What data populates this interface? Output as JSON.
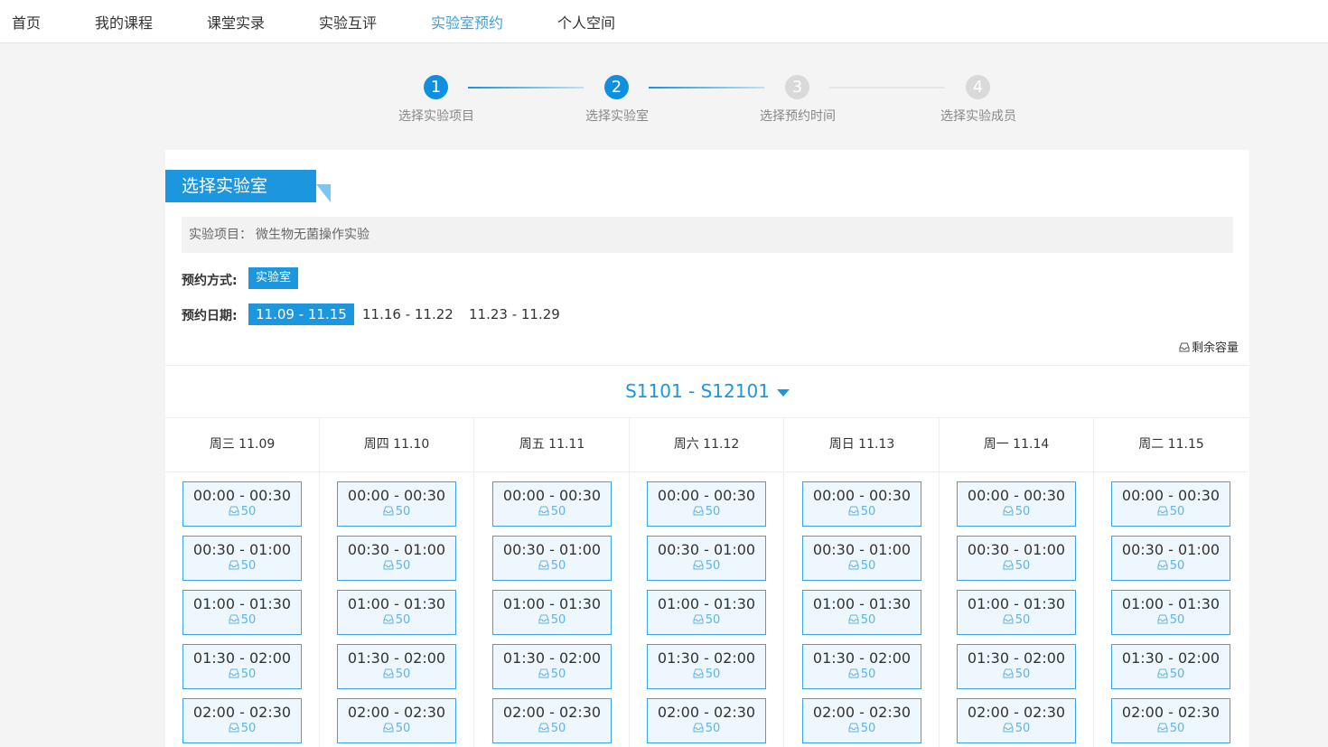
{
  "nav": {
    "items": [
      {
        "label": "首页",
        "active": false
      },
      {
        "label": "我的课程",
        "active": false
      },
      {
        "label": "课堂实录",
        "active": false
      },
      {
        "label": "实验互评",
        "active": false
      },
      {
        "label": "实验室预约",
        "active": true
      },
      {
        "label": "个人空间",
        "active": false
      }
    ]
  },
  "steps": [
    {
      "num": "1",
      "label": "选择实验项目",
      "done": true
    },
    {
      "num": "2",
      "label": "选择实验室",
      "done": true
    },
    {
      "num": "3",
      "label": "选择预约时间",
      "done": false
    },
    {
      "num": "4",
      "label": "选择实验成员",
      "done": false
    }
  ],
  "section_title": "选择实验室",
  "project": {
    "label": "实验项目：",
    "value": "微生物无菌操作实验"
  },
  "mode": {
    "label": "预约方式:",
    "value": "实验室"
  },
  "dates": {
    "label": "预约日期:",
    "options": [
      "11.09 - 11.15",
      "11.16 - 11.22",
      "11.23 - 11.29"
    ],
    "selected_index": 0
  },
  "capacity_legend": "剩余容量",
  "room_range": "S1101 - S12101",
  "accent_color": "#1d96e0",
  "days": [
    "周三 11.09",
    "周四 11.10",
    "周五 11.11",
    "周六 11.12",
    "周日 11.13",
    "周一 11.14",
    "周二 11.15"
  ],
  "slots": [
    {
      "time": "00:00 - 00:30",
      "capacity": "50"
    },
    {
      "time": "00:30 - 01:00",
      "capacity": "50"
    },
    {
      "time": "01:00 - 01:30",
      "capacity": "50"
    },
    {
      "time": "01:30 - 02:00",
      "capacity": "50"
    },
    {
      "time": "02:00 - 02:30",
      "capacity": "50"
    }
  ]
}
